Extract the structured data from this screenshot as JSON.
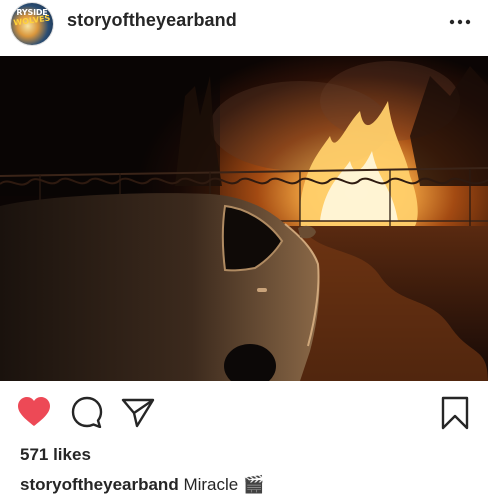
{
  "post": {
    "username": "storyoftheyearband",
    "avatar_text_line1": "RYSIDE",
    "avatar_text_line2": "WOLVES",
    "more_icon": "more-horizontal-icon",
    "likes": "571 likes",
    "caption": {
      "username": "storyoftheyearband",
      "text": "Miracle",
      "emoji": "🎬"
    }
  },
  "actions": {
    "like_icon": "heart-icon",
    "like_color": "#ed4956",
    "comment_icon": "comment-icon",
    "share_icon": "send-icon",
    "save_icon": "bookmark-icon"
  },
  "photo": {
    "subject": "car-and-fire-night-photo"
  }
}
